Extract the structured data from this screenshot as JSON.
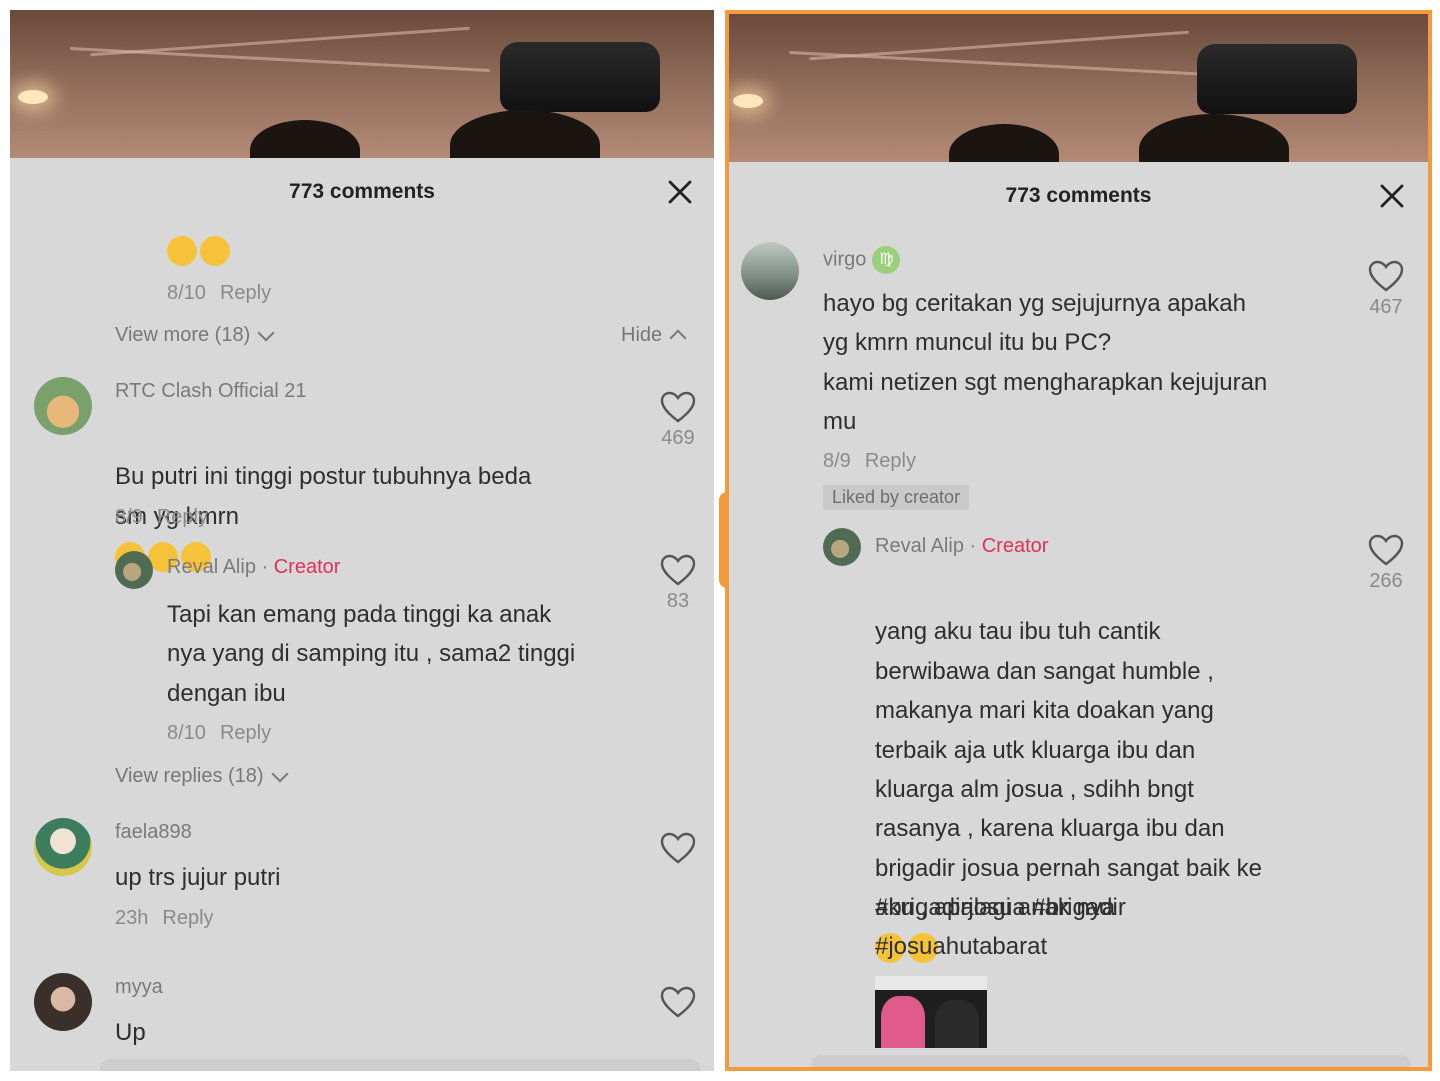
{
  "accent_color": "#f39a3c",
  "creator_color": "#e0325a",
  "left": {
    "header": "773 comments",
    "prev_reply": {
      "emoji": [
        "face-with-tears-of-joy",
        "face-with-tears-of-joy"
      ],
      "date": "8/10",
      "reply": "Reply"
    },
    "view_more": "View more (18)",
    "hide": "Hide",
    "comments": [
      {
        "user": "RTC Clash Official 21",
        "text": "Bu putri ini tinggi postur tubuhnya beda\nsm yg kmrn",
        "emoji": [
          "flushed-face",
          "flushed-face",
          "flushed-face"
        ],
        "date": "8/9",
        "reply": "Reply",
        "likes": "469"
      },
      {
        "user": "Reval Alip",
        "sep": "·",
        "role": "Creator",
        "text": "Tapi kan emang pada tinggi ka anak\nnya yang di samping itu , sama2 tinggi\ndengan ibu",
        "date": "8/10",
        "reply": "Reply",
        "likes": "83"
      },
      {
        "user": "faela898",
        "text": "up trs jujur putri",
        "date": "23h",
        "reply": "Reply"
      },
      {
        "user": "myya",
        "text": "Up"
      }
    ],
    "view_replies": "View replies (18)"
  },
  "right": {
    "header": "773 comments",
    "comments": [
      {
        "user": "virgo",
        "badge_icon": "virgo-symbol-icon",
        "text": "hayo bg ceritakan yg sejujurnya apakah\nyg kmrn muncul itu bu PC?\nkami netizen sgt mengharapkan kejujuran\nmu",
        "date": "8/9",
        "reply": "Reply",
        "likes": "467",
        "liked_by": "Liked by creator"
      },
      {
        "user": "Reval Alip",
        "sep": "·",
        "role": "Creator",
        "text": " yang aku tau ibu tuh cantik\nberwibawa dan sangat humble ,\nmakanya mari kita doakan yang\nterbaik aja utk kluarga ibu dan\nkluarga alm josua , sdihh bngt\nrasanya , karena kluarga ibu dan\nbrigadir josua pernah sangat baik ke\naku , apalagi anak nya",
        "emoji": [
          "loudly-crying-face",
          "loudly-crying-face"
        ],
        "tags": "#brigadirjosua #brigadir\n#josuahutabarat",
        "likes": "266"
      }
    ]
  }
}
